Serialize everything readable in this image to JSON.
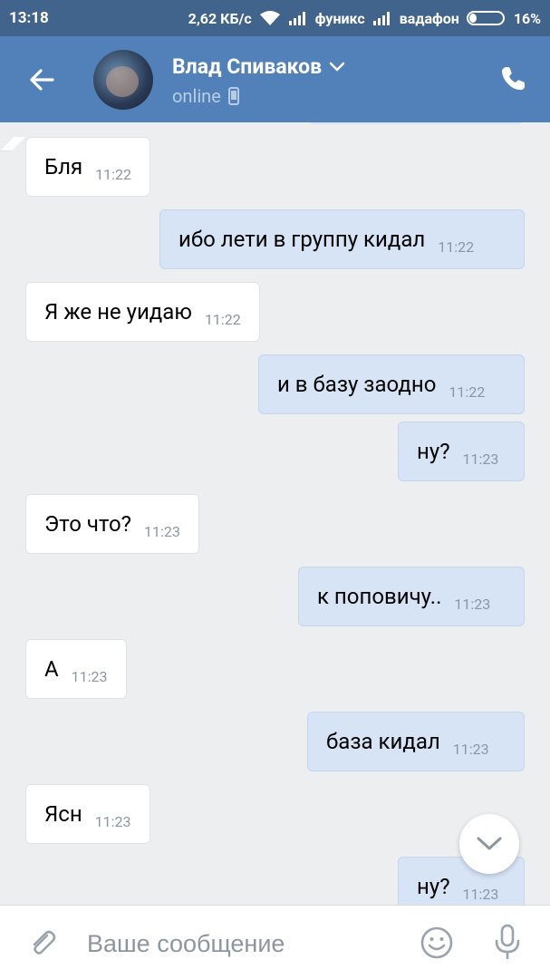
{
  "status_bar": {
    "time": "13:18",
    "speed": "2,62 КБ/с",
    "carrier1": "фуникс",
    "carrier2": "вадафон",
    "battery": "16%"
  },
  "header": {
    "contact_name": "Влад Спиваков",
    "status": "online",
    "back_icon": "arrow-left-icon",
    "call_icon": "phone-icon"
  },
  "messages": [
    {
      "dir": "in",
      "text": "Бля",
      "time": "11:22"
    },
    {
      "dir": "out",
      "text": "ибо лети в группу кидал",
      "time": "11:22"
    },
    {
      "dir": "in",
      "text": "Я же не уидаю",
      "time": "11:22"
    },
    {
      "dir": "out",
      "text": "и в базу заодно",
      "time": "11:22"
    },
    {
      "dir": "out",
      "text": "ну?",
      "time": "11:23"
    },
    {
      "dir": "in",
      "text": "Это что?",
      "time": "11:23"
    },
    {
      "dir": "out",
      "text": "к поповичу..",
      "time": "11:23"
    },
    {
      "dir": "in",
      "text": "А",
      "time": "11:23"
    },
    {
      "dir": "out",
      "text": "база кидал",
      "time": "11:23"
    },
    {
      "dir": "in",
      "text": "Ясн",
      "time": "11:23"
    },
    {
      "dir": "out",
      "text": "ну?",
      "time": "11:23"
    }
  ],
  "composer": {
    "placeholder": "Ваше сообщение",
    "attach_icon": "paperclip-icon",
    "emoji_icon": "smiley-icon",
    "mic_icon": "microphone-icon"
  },
  "colors": {
    "header_bg": "#5181b8",
    "status_bar_bg": "#40648c",
    "chat_bg": "#edeef0",
    "outgoing_bubble": "#d6e4f6",
    "incoming_bubble": "#ffffff"
  }
}
